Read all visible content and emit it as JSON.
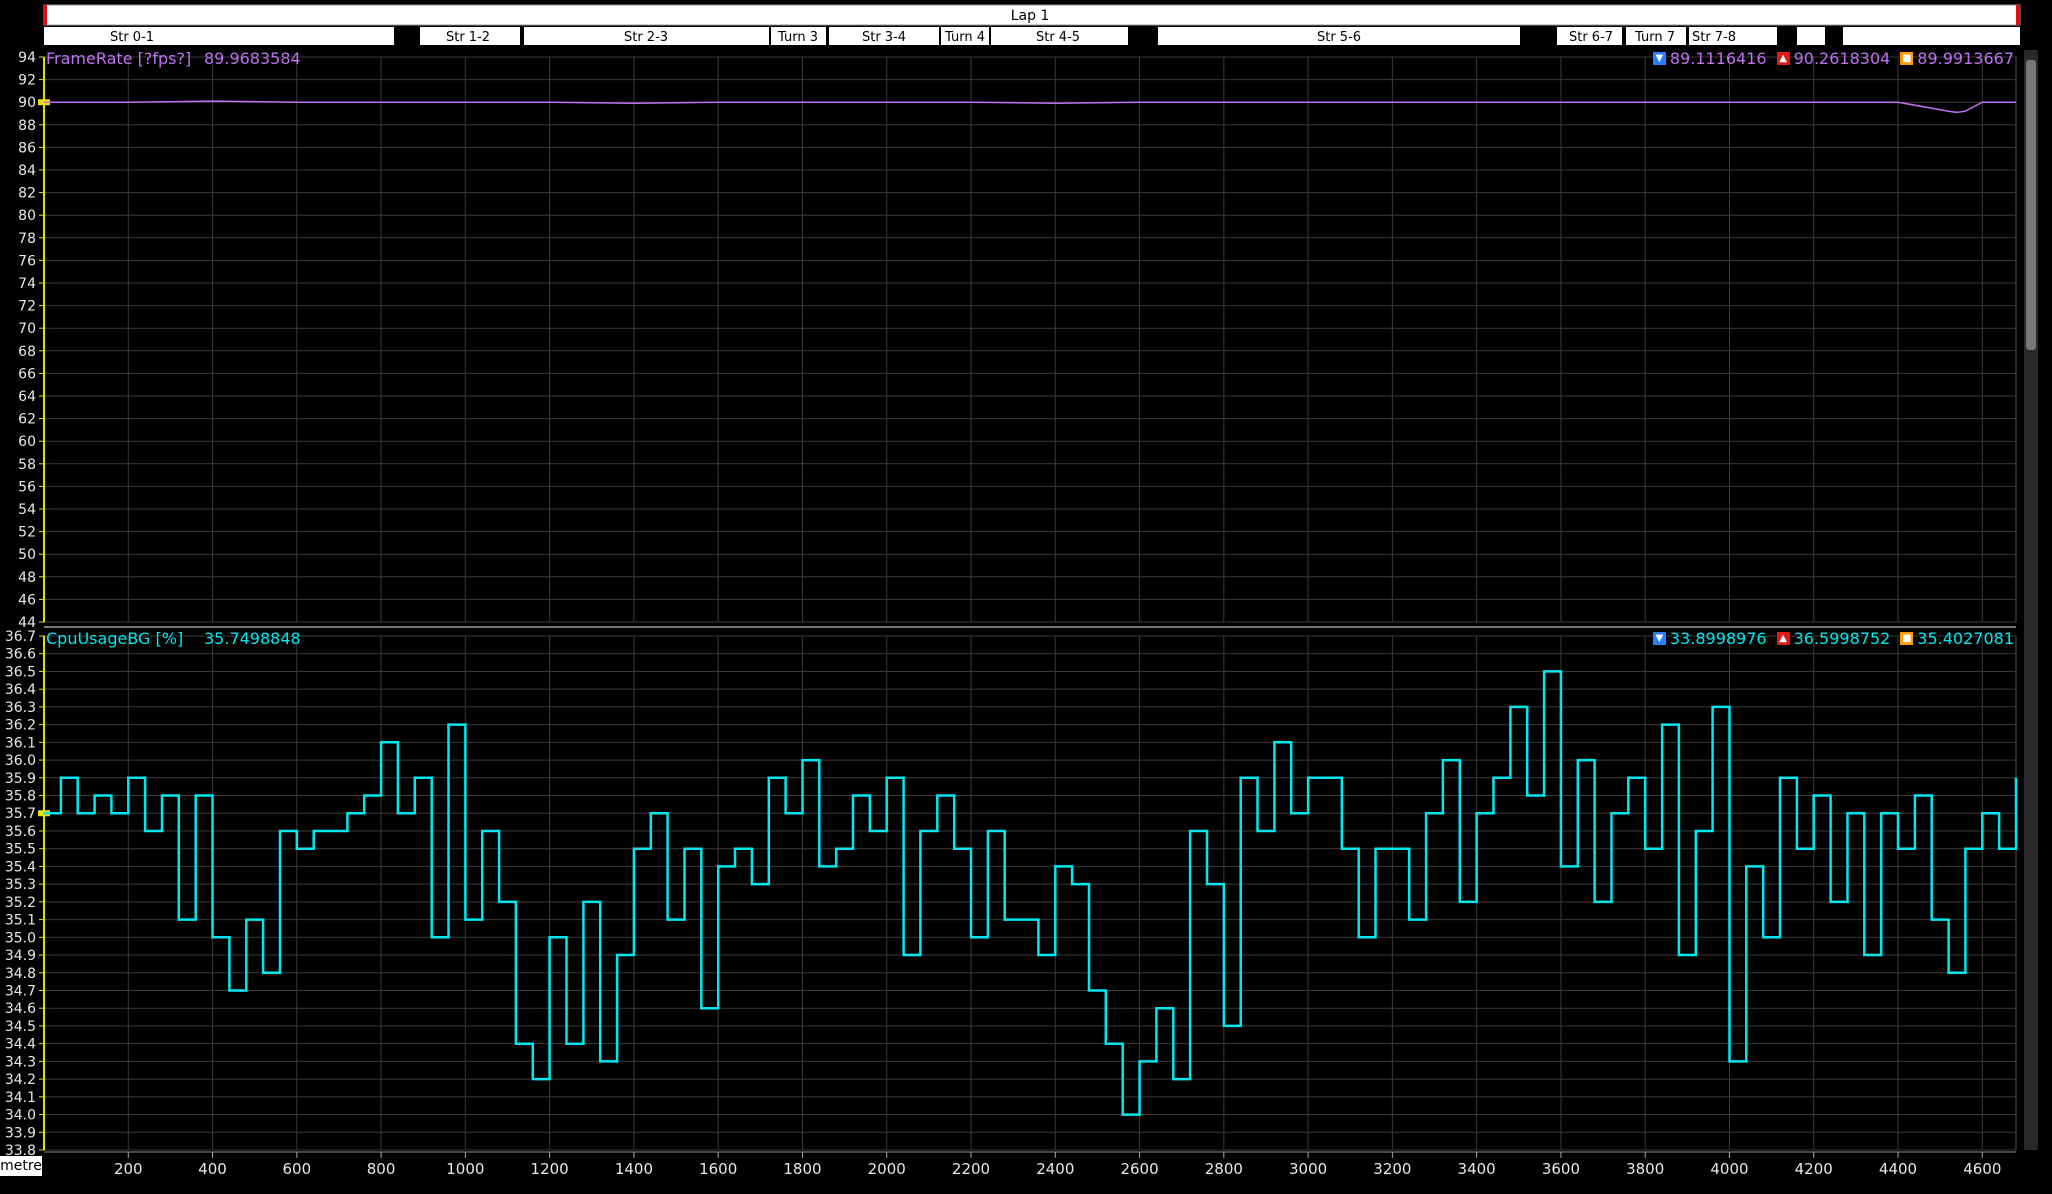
{
  "lap": {
    "label": "Lap 1"
  },
  "segments": [
    "Str 0-1",
    "Str 1-2",
    "Str 2-3",
    "Turn 3",
    "Str 3-4",
    "Turn 4",
    "Str 4-5",
    "Str 5-6",
    "Str 6-7",
    "Turn 7",
    "Str 7-8"
  ],
  "x_axis": {
    "unit": "metre"
  },
  "colors": {
    "framerate": "#c070f0",
    "cpu": "#00e8f0",
    "background": "#000000",
    "grid": "#3a3a3a"
  },
  "channels": {
    "framerate": {
      "name": "FrameRate [?fps?]",
      "cursor_value": "89.9683584",
      "min": "89.1116416",
      "max": "90.2618304",
      "avg": "89.9913667"
    },
    "cpu": {
      "name": "CpuUsageBG [%]",
      "cursor_value": "35.7498848",
      "min": "33.8998976",
      "max": "36.5998752",
      "avg": "35.4027081"
    }
  },
  "chart_data": [
    {
      "type": "line",
      "title": "",
      "series": [
        {
          "name": "FrameRate [?fps?]"
        }
      ],
      "xlabel": "metre",
      "ylabel": "",
      "xlim": [
        0,
        4680
      ],
      "ylim": [
        44,
        94
      ],
      "grid": true,
      "x_ticks": [
        200,
        400,
        600,
        800,
        1000,
        1200,
        1400,
        1600,
        1800,
        2000,
        2200,
        2400,
        2600,
        2800,
        3000,
        3200,
        3400,
        3600,
        3800,
        4000,
        4200,
        4400,
        4600
      ],
      "y_ticks": [
        44,
        46,
        48,
        50,
        52,
        54,
        56,
        58,
        60,
        62,
        64,
        66,
        68,
        70,
        72,
        74,
        76,
        78,
        80,
        82,
        84,
        86,
        88,
        90,
        92,
        94
      ],
      "x": [
        0,
        200,
        400,
        600,
        800,
        1000,
        1200,
        1400,
        1600,
        1800,
        2000,
        2200,
        2400,
        2600,
        2800,
        3000,
        3200,
        3400,
        3600,
        3800,
        4000,
        4200,
        4400,
        4520,
        4540,
        4560,
        4600,
        4680
      ],
      "y": [
        90.0,
        90.0,
        90.1,
        90.0,
        90.0,
        90.0,
        90.0,
        89.9,
        90.0,
        90.0,
        90.0,
        90.0,
        89.9,
        90.0,
        90.0,
        90.0,
        90.0,
        90.0,
        90.0,
        90.0,
        90.0,
        90.0,
        90.0,
        89.2,
        89.1,
        89.2,
        90.0,
        90.0
      ]
    },
    {
      "type": "line",
      "title": "",
      "series": [
        {
          "name": "CpuUsageBG [%]"
        }
      ],
      "xlabel": "metre",
      "ylabel": "",
      "xlim": [
        0,
        4680
      ],
      "ylim": [
        33.8,
        36.7
      ],
      "grid": true,
      "x_ticks": [
        200,
        400,
        600,
        800,
        1000,
        1200,
        1400,
        1600,
        1800,
        2000,
        2200,
        2400,
        2600,
        2800,
        3000,
        3200,
        3400,
        3600,
        3800,
        4000,
        4200,
        4400,
        4600
      ],
      "y_ticks": [
        33.8,
        33.9,
        34.0,
        34.1,
        34.2,
        34.3,
        34.4,
        34.5,
        34.6,
        34.7,
        34.8,
        34.9,
        35.0,
        35.1,
        35.2,
        35.3,
        35.4,
        35.5,
        35.6,
        35.7,
        35.8,
        35.9,
        36.0,
        36.1,
        36.2,
        36.3,
        36.4,
        36.5,
        36.6,
        36.7
      ],
      "x": [
        0,
        40,
        80,
        120,
        160,
        200,
        240,
        280,
        320,
        360,
        400,
        440,
        480,
        520,
        560,
        600,
        640,
        680,
        720,
        760,
        800,
        840,
        880,
        920,
        960,
        1000,
        1040,
        1080,
        1120,
        1160,
        1200,
        1240,
        1280,
        1320,
        1360,
        1400,
        1440,
        1480,
        1520,
        1560,
        1600,
        1640,
        1680,
        1720,
        1760,
        1800,
        1840,
        1880,
        1920,
        1960,
        2000,
        2040,
        2080,
        2120,
        2160,
        2200,
        2240,
        2280,
        2320,
        2360,
        2400,
        2440,
        2480,
        2520,
        2560,
        2600,
        2640,
        2680,
        2720,
        2760,
        2800,
        2840,
        2880,
        2920,
        2960,
        3000,
        3040,
        3080,
        3120,
        3160,
        3200,
        3240,
        3280,
        3320,
        3360,
        3400,
        3440,
        3480,
        3520,
        3560,
        3600,
        3640,
        3680,
        3720,
        3760,
        3800,
        3840,
        3880,
        3920,
        3960,
        4000,
        4040,
        4080,
        4120,
        4160,
        4200,
        4240,
        4280,
        4320,
        4360,
        4400,
        4440,
        4480,
        4520,
        4560,
        4600,
        4640,
        4680
      ],
      "y": [
        35.7,
        35.9,
        35.7,
        35.8,
        35.7,
        35.9,
        35.6,
        35.8,
        35.1,
        35.8,
        35.0,
        34.7,
        35.1,
        34.8,
        35.6,
        35.5,
        35.6,
        35.6,
        35.7,
        35.8,
        36.1,
        35.7,
        35.9,
        35.0,
        36.2,
        35.1,
        35.6,
        35.2,
        34.4,
        34.2,
        35.0,
        34.4,
        35.2,
        34.3,
        34.9,
        35.5,
        35.7,
        35.1,
        35.5,
        34.6,
        35.4,
        35.5,
        35.3,
        35.9,
        35.7,
        36.0,
        35.4,
        35.5,
        35.8,
        35.6,
        35.9,
        34.9,
        35.6,
        35.8,
        35.5,
        35.0,
        35.6,
        35.1,
        35.1,
        34.9,
        35.4,
        35.3,
        34.7,
        34.4,
        34.0,
        34.3,
        34.6,
        34.2,
        35.6,
        35.3,
        34.5,
        35.9,
        35.6,
        36.1,
        35.7,
        35.9,
        35.9,
        35.5,
        35.0,
        35.5,
        35.5,
        35.1,
        35.7,
        36.0,
        35.2,
        35.7,
        35.9,
        36.3,
        35.8,
        36.5,
        35.4,
        36.0,
        35.2,
        35.7,
        35.9,
        35.5,
        36.2,
        34.9,
        35.6,
        36.3,
        34.3,
        35.4,
        35.0,
        35.9,
        35.5,
        35.8,
        35.2,
        35.7,
        34.9,
        35.7,
        35.5,
        35.8,
        35.1,
        34.8,
        35.5,
        35.7,
        35.5,
        35.9
      ]
    }
  ]
}
